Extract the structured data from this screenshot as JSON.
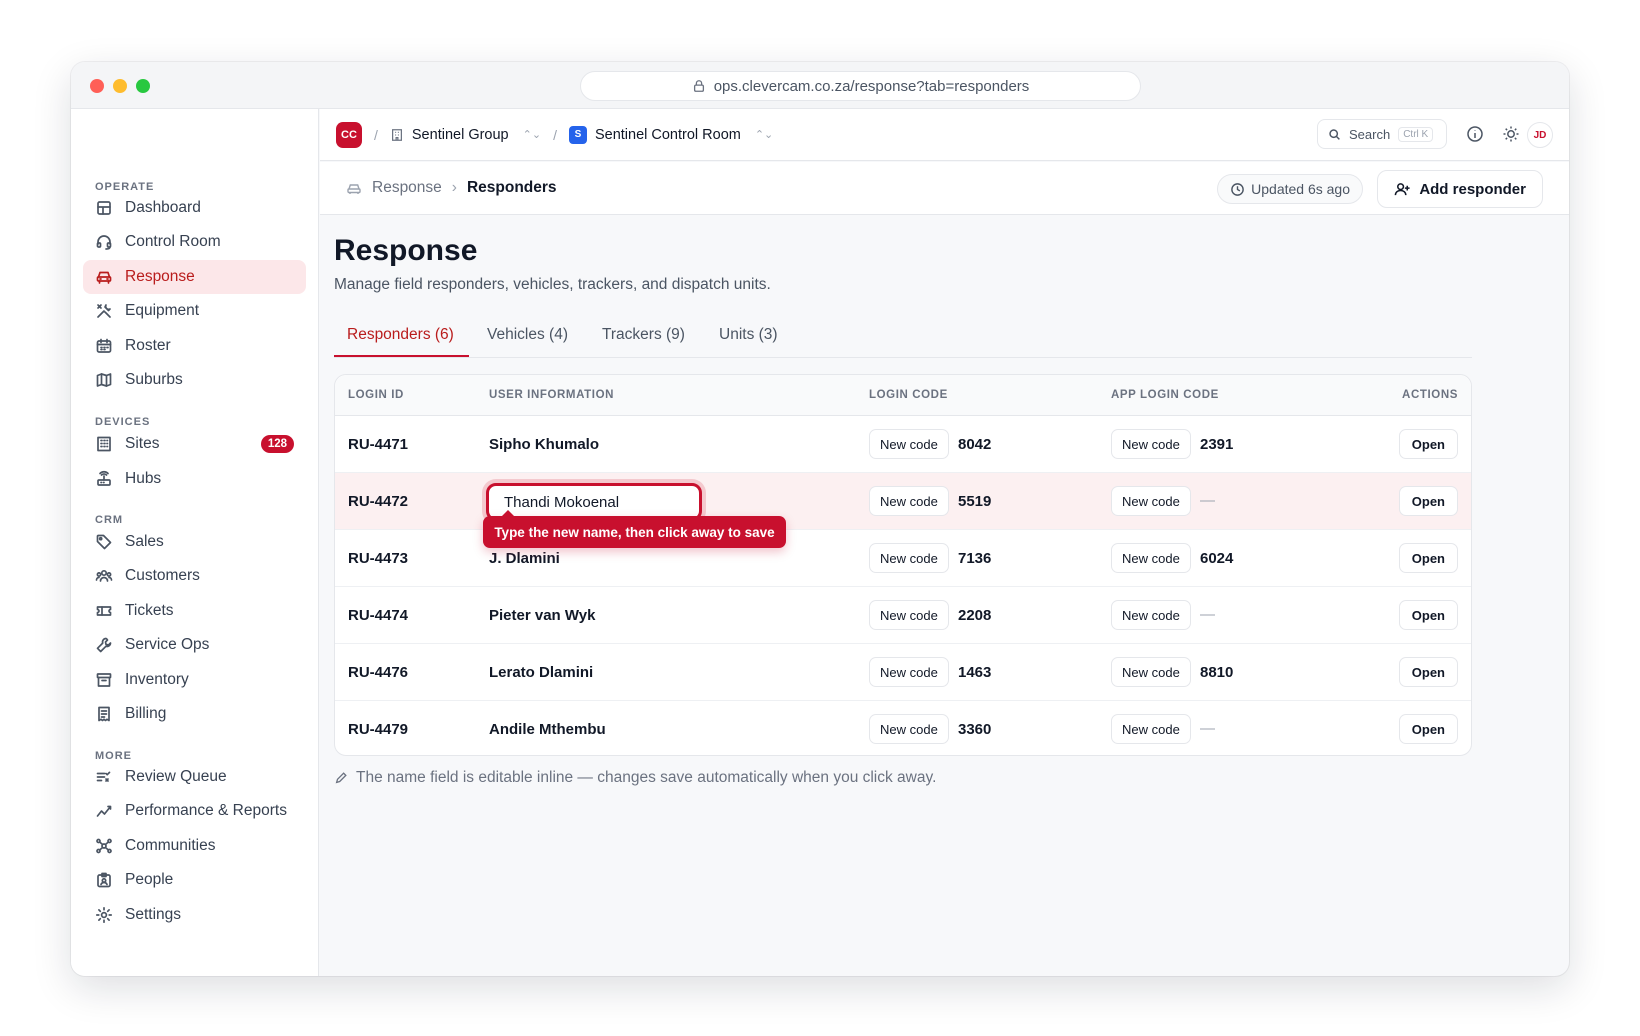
{
  "browser": {
    "url": "ops.clevercam.co.za/response?tab=responders"
  },
  "sidebar": {
    "sections": [
      {
        "label": "OPERATE"
      },
      {
        "label": "DEVICES"
      },
      {
        "label": "CRM"
      },
      {
        "label": "MORE"
      }
    ],
    "items": [
      {
        "label": "Dashboard",
        "icon": "layout-icon"
      },
      {
        "label": "Control Room",
        "icon": "headset-icon"
      },
      {
        "label": "Response",
        "icon": "car-icon",
        "active": true
      },
      {
        "label": "Equipment",
        "icon": "tools-icon"
      },
      {
        "label": "Roster",
        "icon": "calendar-icon"
      },
      {
        "label": "Suburbs",
        "icon": "map-icon"
      },
      {
        "label": "Sites",
        "icon": "building-icon",
        "badge": "128"
      },
      {
        "label": "Hubs",
        "icon": "router-icon"
      },
      {
        "label": "Sales",
        "icon": "tag-icon"
      },
      {
        "label": "Customers",
        "icon": "users-icon"
      },
      {
        "label": "Tickets",
        "icon": "ticket-icon"
      },
      {
        "label": "Service Ops",
        "icon": "wrench-icon"
      },
      {
        "label": "Inventory",
        "icon": "archive-icon"
      },
      {
        "label": "Billing",
        "icon": "receipt-icon"
      },
      {
        "label": "Review Queue",
        "icon": "list-check-icon"
      },
      {
        "label": "Performance & Reports",
        "icon": "chart-line-icon"
      },
      {
        "label": "Communities",
        "icon": "network-icon"
      },
      {
        "label": "People",
        "icon": "id-badge-icon"
      },
      {
        "label": "Settings",
        "icon": "gear-icon"
      }
    ]
  },
  "topbar": {
    "org_logo": "CC",
    "org_name": "Sentinel Group",
    "workspace_logo": "S",
    "workspace_name": "Sentinel Control Room",
    "search_label": "Search",
    "search_shortcut": "Ctrl K",
    "avatar": "JD"
  },
  "subbar": {
    "breadcrumb_parent": "Response",
    "breadcrumb_current": "Responders",
    "updated": "Updated 6s ago",
    "add_button": "Add responder"
  },
  "page": {
    "title": "Response",
    "subtitle": "Manage field responders, vehicles, trackers, and dispatch units."
  },
  "tabs": [
    {
      "label": "Responders (6)",
      "active": true
    },
    {
      "label": "Vehicles (4)"
    },
    {
      "label": "Trackers (9)"
    },
    {
      "label": "Units (3)"
    }
  ],
  "table": {
    "headers": [
      "LOGIN ID",
      "USER INFORMATION",
      "LOGIN CODE",
      "APP LOGIN CODE",
      "ACTIONS"
    ],
    "new_code_label": "New code",
    "open_label": "Open",
    "empty_value": "—",
    "rows": [
      {
        "login_id": "RU-4471",
        "name": "Sipho Khumalo",
        "login_code": "8042",
        "app_code": "2391"
      },
      {
        "login_id": "RU-4472",
        "name": "Thandi Mokoenal",
        "login_code": "5519",
        "app_code": ""
      },
      {
        "login_id": "RU-4473",
        "name": "J. Dlamini",
        "login_code": "7136",
        "app_code": "6024"
      },
      {
        "login_id": "RU-4474",
        "name": "Pieter van Wyk",
        "login_code": "2208",
        "app_code": ""
      },
      {
        "login_id": "RU-4476",
        "name": "Lerato Dlamini",
        "login_code": "1463",
        "app_code": "8810"
      },
      {
        "login_id": "RU-4479",
        "name": "Andile Mthembu",
        "login_code": "3360",
        "app_code": ""
      }
    ],
    "editing_row": 1,
    "tooltip": "Type the new name, then click away to save"
  },
  "footnote": "The name field is editable inline — changes save automatically when you click away.",
  "colors": {
    "accent": "#c8102e",
    "active_bg": "#fce7e9",
    "workspace": "#2563eb"
  }
}
